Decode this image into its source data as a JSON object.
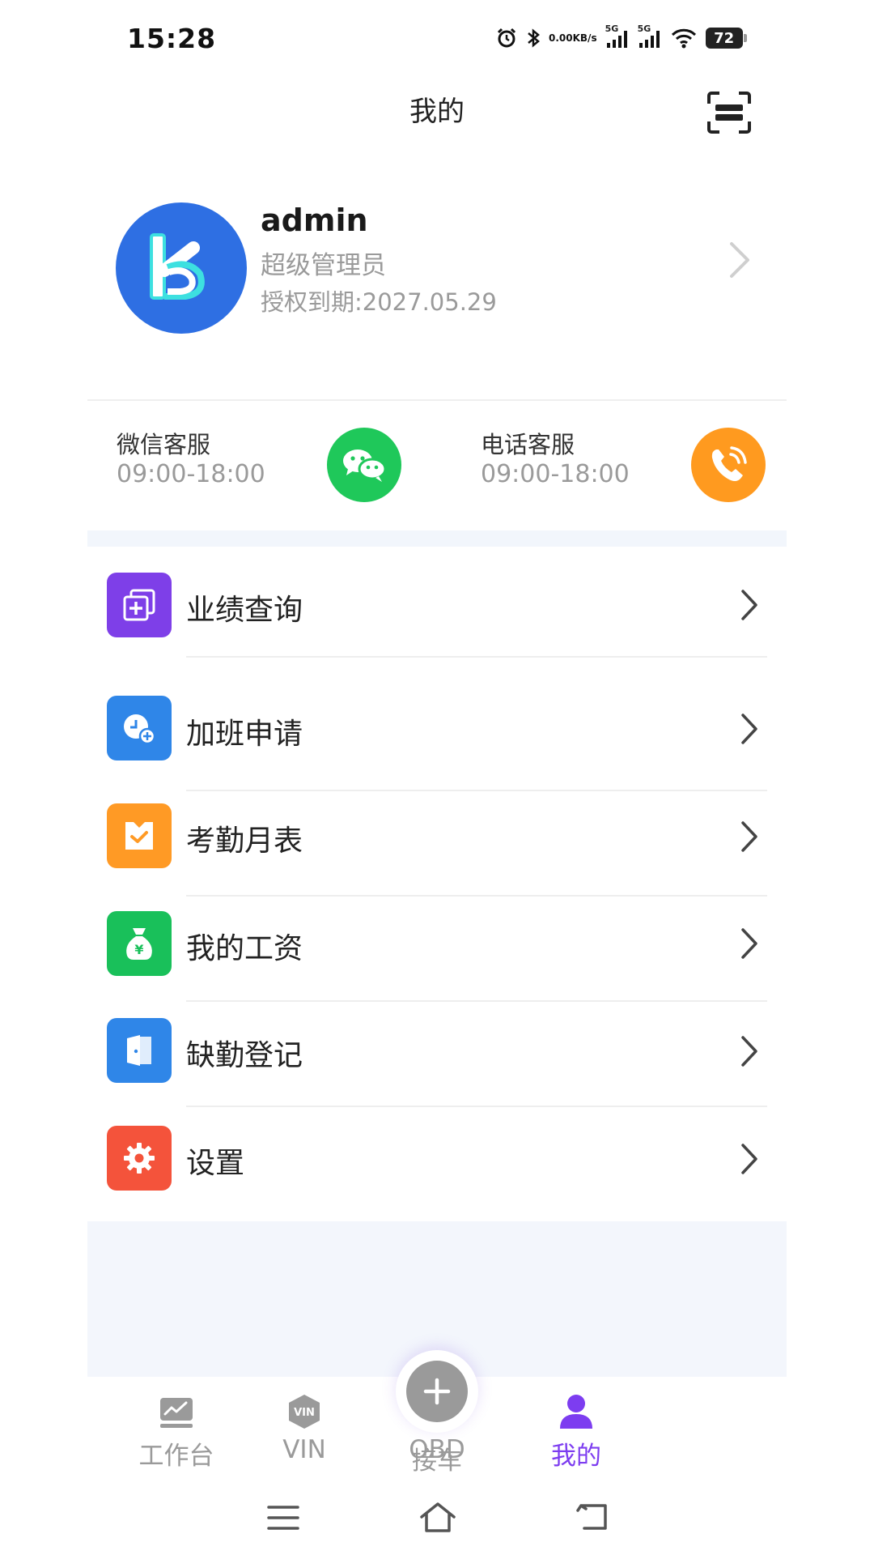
{
  "status_bar": {
    "time": "15:28",
    "net_speed_value": "0.00",
    "net_speed_unit": "KB/s",
    "sim1": "5G",
    "sim2": "5G",
    "battery": "72",
    "icons": [
      "alarm-icon",
      "bluetooth-icon",
      "signal-icon",
      "signal-icon",
      "wifi-icon",
      "battery-icon"
    ]
  },
  "header": {
    "title": "我的",
    "scan_icon": "scan-icon"
  },
  "profile": {
    "username": "admin",
    "role": "超级管理员",
    "expiry": "授权到期:2027.05.29"
  },
  "support": {
    "wechat": {
      "title": "微信客服",
      "hours": "09:00-18:00",
      "icon": "wechat-icon",
      "color": "#1fc85a"
    },
    "phone": {
      "title": "电话客服",
      "hours": "09:00-18:00",
      "icon": "phone-icon",
      "color": "#ff9a1f"
    }
  },
  "menu": {
    "items": [
      {
        "label": "业绩查询",
        "icon": "performance-icon",
        "color": "#7e3fe8"
      },
      {
        "label": "加班申请",
        "icon": "clock-add-icon",
        "color": "#2f86e8"
      },
      {
        "label": "考勤月表",
        "icon": "calendar-check-icon",
        "color": "#ff9a25"
      },
      {
        "label": "我的工资",
        "icon": "money-bag-icon",
        "color": "#19c05a"
      },
      {
        "label": "缺勤登记",
        "icon": "door-icon",
        "color": "#2f86e8"
      },
      {
        "label": "设置",
        "icon": "gear-icon",
        "color": "#f4533b"
      }
    ]
  },
  "tabbar": {
    "items": [
      {
        "label": "工作台",
        "icon": "dashboard-icon",
        "active": false
      },
      {
        "label": "VIN",
        "icon": "vin-icon",
        "icon_text": "VIN",
        "active": false
      },
      {
        "label": "接车",
        "icon": "plus-icon",
        "active": false
      },
      {
        "label": "OBD",
        "icon": "engine-icon",
        "active": false
      },
      {
        "label": "我的",
        "icon": "user-icon",
        "active": true
      }
    ],
    "active_color": "#7d3df0"
  },
  "system_nav": [
    "menu-icon",
    "home-icon",
    "back-icon"
  ]
}
